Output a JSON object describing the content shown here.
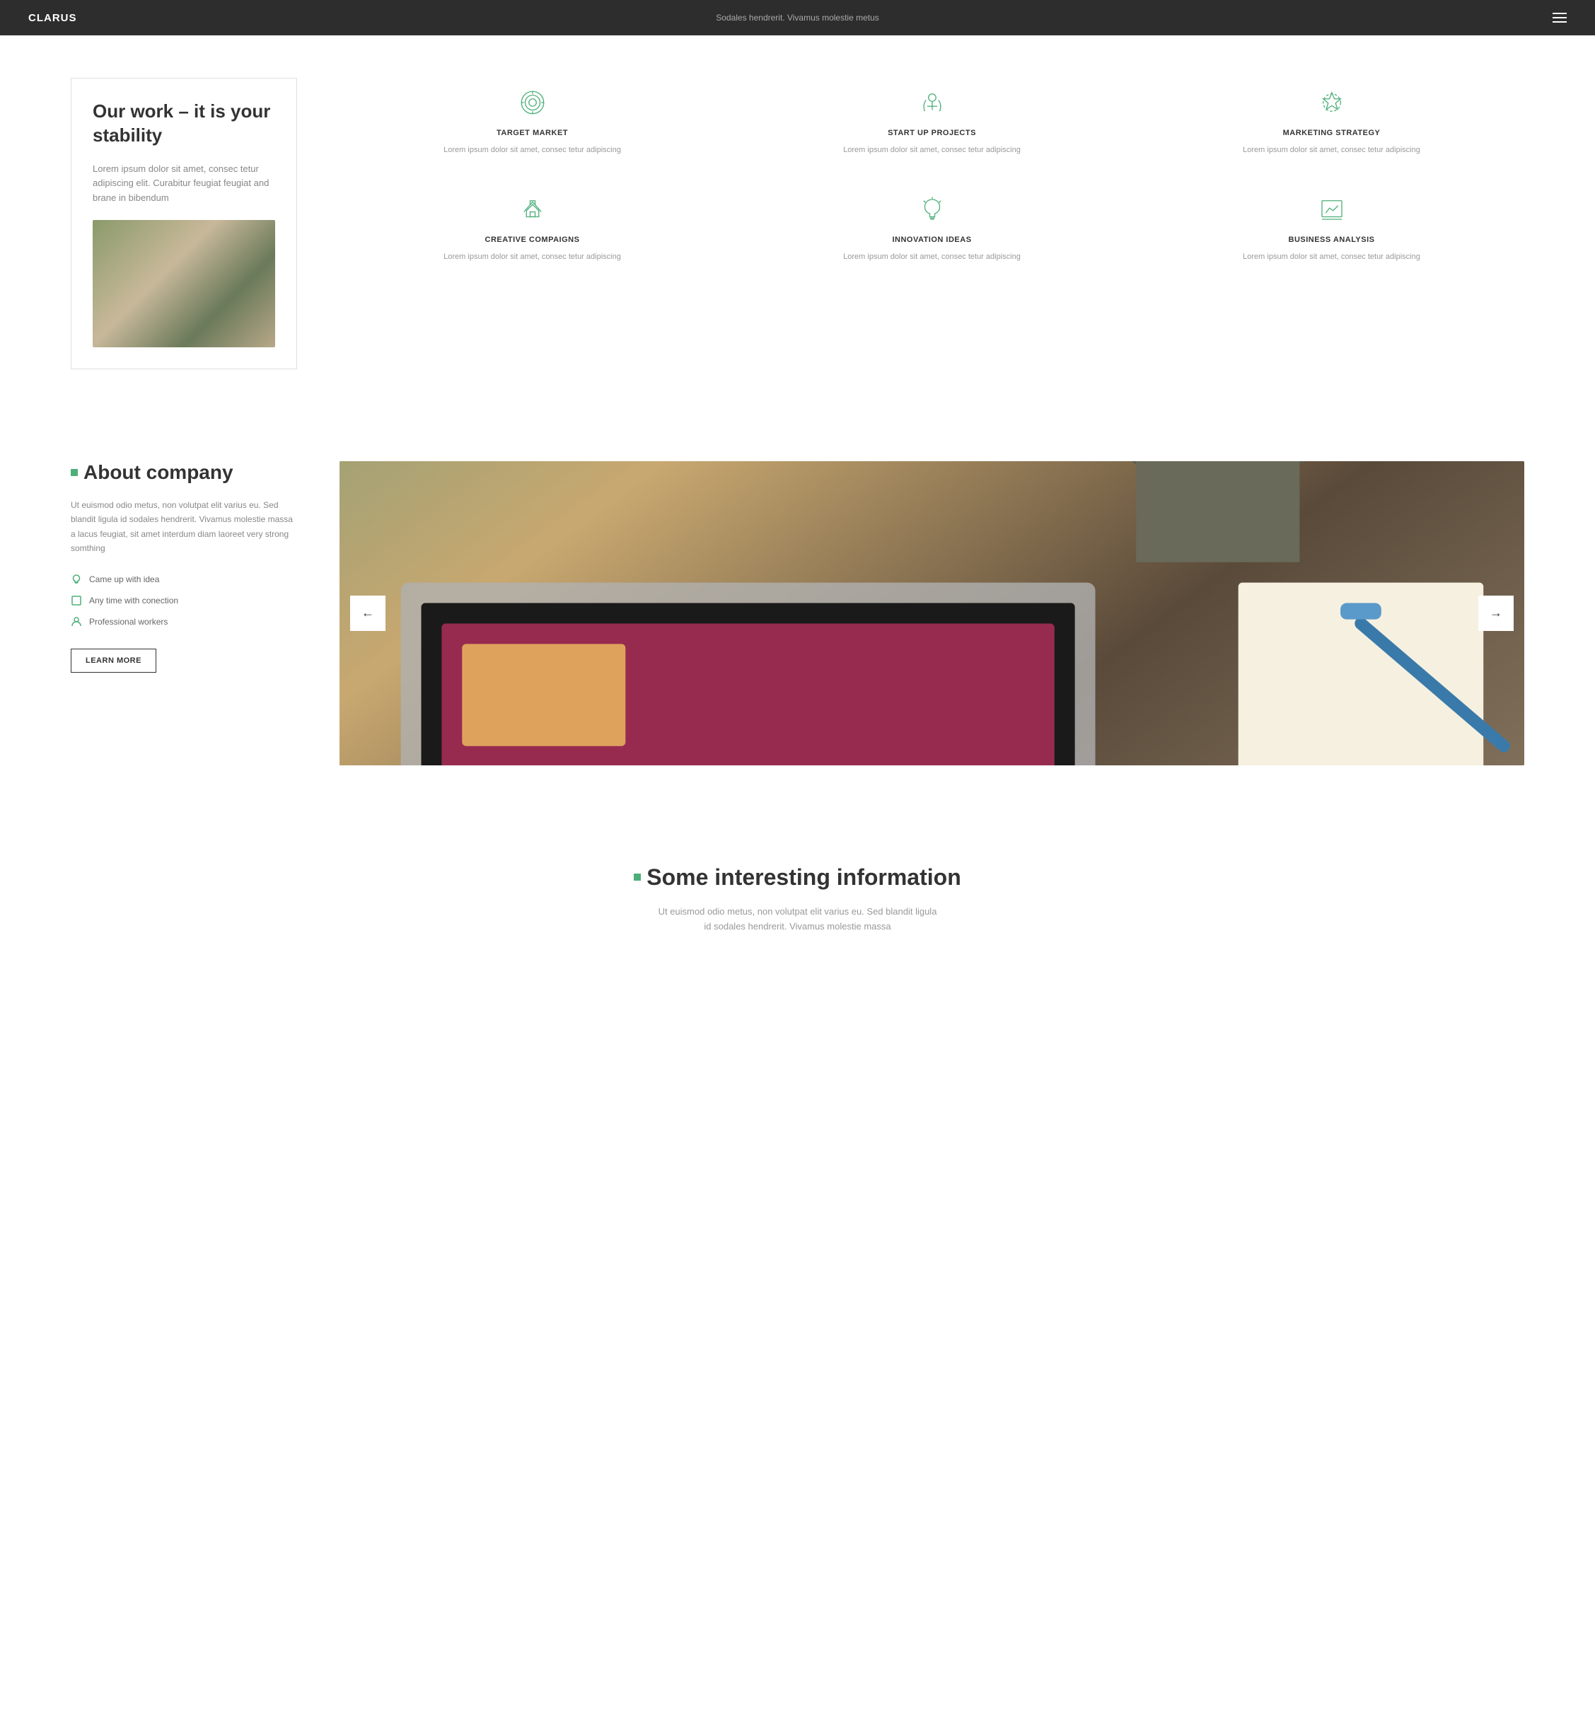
{
  "navbar": {
    "logo": "CLARUS",
    "center_text": "Sodales hendrerit. Vivamus molestie metus",
    "menu_icon": "≡"
  },
  "section_work": {
    "title": "Our work – it is your stability",
    "description": "Lorem ipsum dolor sit amet, consec tetur adipiscing elit. Curabitur feugiat feugiat and brane in bibendum",
    "features": [
      {
        "id": "target-market",
        "title": "TARGET MARKET",
        "description": "Lorem ipsum dolor sit amet, consec tetur adipiscing",
        "icon": "target"
      },
      {
        "id": "startup-projects",
        "title": "START UP PROJECTS",
        "description": "Lorem ipsum dolor sit amet, consec tetur adipiscing",
        "icon": "telescope"
      },
      {
        "id": "marketing-strategy",
        "title": "MARKETING STRATEGY",
        "description": "Lorem ipsum dolor sit amet, consec tetur adipiscing",
        "icon": "chess-knight"
      },
      {
        "id": "creative-campaigns",
        "title": "CREATIVE COMPAIGNS",
        "description": "Lorem ipsum dolor sit amet, consec tetur adipiscing",
        "icon": "trophy"
      },
      {
        "id": "innovation-ideas",
        "title": "INNOVATION IDEAS",
        "description": "Lorem ipsum dolor sit amet, consec tetur adipiscing",
        "icon": "lightbulb"
      },
      {
        "id": "business-analysis",
        "title": "BUSINESS ANALYSIS",
        "description": "Lorem ipsum dolor sit amet, consec tetur adipiscing",
        "icon": "chart"
      }
    ]
  },
  "section_about": {
    "heading": "About company",
    "description": "Ut euismod odio metus, non volutpat elit varius eu. Sed blandit ligula id sodales hendrerit. Vivamus molestie massa a lacus feugiat, sit amet interdum diam laoreet very strong somthing",
    "list_items": [
      {
        "text": "Came up with idea",
        "icon": "lightbulb"
      },
      {
        "text": "Any time with conection",
        "icon": "square"
      },
      {
        "text": "Professional workers",
        "icon": "person"
      }
    ],
    "button_label": "LEARN MORE",
    "slider_left": "←",
    "slider_right": "→"
  },
  "section_info": {
    "heading": "Some interesting information",
    "description": "Ut euismod odio metus, non volutpat elit varius eu. Sed blandit ligula id sodales hendrerit. Vivamus molestie massa"
  }
}
